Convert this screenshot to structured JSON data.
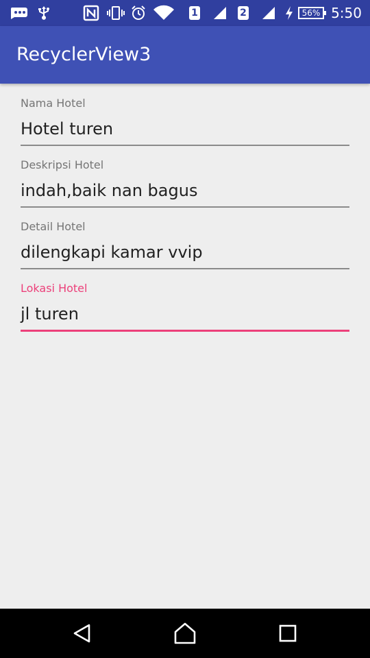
{
  "status_bar": {
    "time": "5:50",
    "battery": "56%",
    "sim1": "1",
    "sim2": "2"
  },
  "app_bar": {
    "title": "RecyclerView3"
  },
  "form": {
    "fields": [
      {
        "label": "Nama Hotel",
        "value": "Hotel turen"
      },
      {
        "label": "Deskripsi Hotel",
        "value": "indah,baik nan bagus"
      },
      {
        "label": "Detail Hotel",
        "value": "dilengkapi kamar vvip"
      },
      {
        "label": "Lokasi Hotel",
        "value": "jl turen"
      }
    ]
  },
  "colors": {
    "status_bar": "#303f9f",
    "primary": "#3f51b5",
    "accent": "#ec407a",
    "background": "#eeeeee"
  },
  "nav_bar": {
    "buttons": [
      "back-icon",
      "home-icon",
      "recents-icon"
    ]
  }
}
